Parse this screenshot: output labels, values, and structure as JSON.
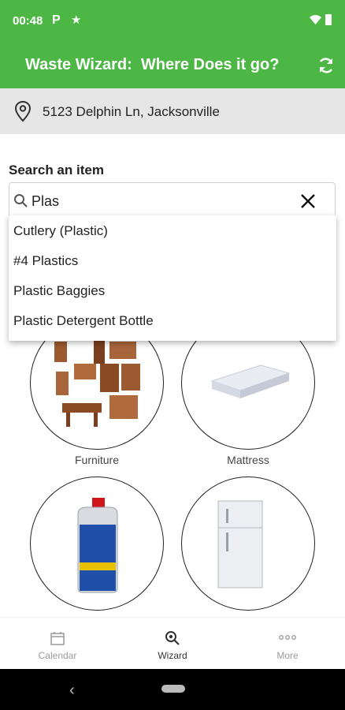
{
  "status": {
    "time": "00:48"
  },
  "appbar": {
    "title": "Waste Wizard:  Where Does it go?"
  },
  "location": {
    "address": "5123 Delphin Ln, Jacksonville"
  },
  "search": {
    "label": "Search an item",
    "value": "Plas"
  },
  "suggestions": [
    "Cutlery (Plastic)",
    "#4 Plastics",
    "Plastic Baggies",
    "Plastic Detergent Bottle"
  ],
  "tiles": [
    {
      "label": "Furniture"
    },
    {
      "label": "Mattress"
    },
    {
      "label": "",
      "image": "motor-oil-bottle"
    },
    {
      "label": "",
      "image": "refrigerator"
    }
  ],
  "nav": {
    "items": [
      {
        "label": "Calendar"
      },
      {
        "label": "Wizard"
      },
      {
        "label": "More"
      }
    ]
  },
  "colors": {
    "brand": "#4cb745"
  }
}
